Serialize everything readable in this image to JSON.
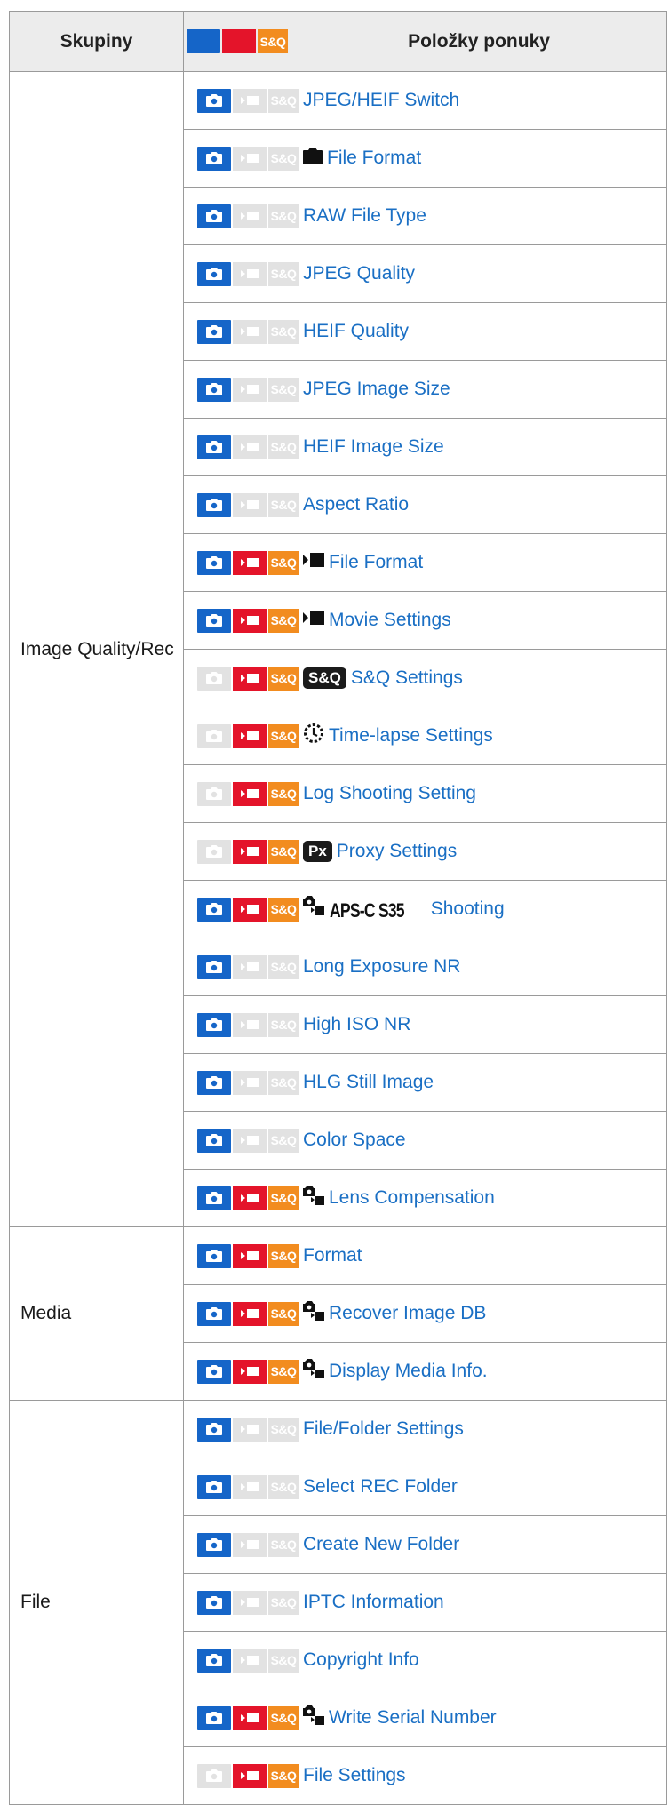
{
  "table": {
    "headers": {
      "groups": "Skupiny",
      "availability": "S&Q",
      "items": "Položky ponuky"
    },
    "groups": [
      {
        "name": "Image Quality/Rec",
        "rows": [
          {
            "label": "JPEG/HEIF Switch",
            "photo": true,
            "movie": false,
            "sq": false,
            "prefix": ""
          },
          {
            "label": "File Format",
            "photo": true,
            "movie": false,
            "sq": false,
            "prefix": "camera-icon"
          },
          {
            "label": "RAW File Type",
            "photo": true,
            "movie": false,
            "sq": false,
            "prefix": ""
          },
          {
            "label": "JPEG Quality",
            "photo": true,
            "movie": false,
            "sq": false,
            "prefix": ""
          },
          {
            "label": "HEIF Quality",
            "photo": true,
            "movie": false,
            "sq": false,
            "prefix": ""
          },
          {
            "label": "JPEG Image Size",
            "photo": true,
            "movie": false,
            "sq": false,
            "prefix": ""
          },
          {
            "label": "HEIF Image Size",
            "photo": true,
            "movie": false,
            "sq": false,
            "prefix": ""
          },
          {
            "label": "Aspect Ratio",
            "photo": true,
            "movie": false,
            "sq": false,
            "prefix": ""
          },
          {
            "label": "File Format",
            "photo": true,
            "movie": true,
            "sq": true,
            "prefix": "movie-icon"
          },
          {
            "label": "Movie Settings",
            "photo": true,
            "movie": true,
            "sq": true,
            "prefix": "movie-icon"
          },
          {
            "label": "S&Q Settings",
            "photo": false,
            "movie": true,
            "sq": true,
            "prefix": "sq-badge-icon"
          },
          {
            "label": "Time-lapse Settings",
            "photo": false,
            "movie": true,
            "sq": true,
            "prefix": "timelapse-icon"
          },
          {
            "label": "Log Shooting Setting",
            "photo": false,
            "movie": true,
            "sq": true,
            "prefix": ""
          },
          {
            "label": "Proxy Settings",
            "photo": false,
            "movie": true,
            "sq": true,
            "prefix": "px-badge-icon"
          },
          {
            "label": "Shooting",
            "photo": true,
            "movie": true,
            "sq": true,
            "prefix": "shared-aps-icon",
            "prefix_text": "APS-C S35"
          },
          {
            "label": "Long Exposure NR",
            "photo": true,
            "movie": false,
            "sq": false,
            "prefix": ""
          },
          {
            "label": "High ISO NR",
            "photo": true,
            "movie": false,
            "sq": false,
            "prefix": ""
          },
          {
            "label": "HLG Still Image",
            "photo": true,
            "movie": false,
            "sq": false,
            "prefix": ""
          },
          {
            "label": "Color Space",
            "photo": true,
            "movie": false,
            "sq": false,
            "prefix": ""
          },
          {
            "label": "Lens Compensation",
            "photo": true,
            "movie": true,
            "sq": true,
            "prefix": "shared-icon"
          }
        ]
      },
      {
        "name": "Media",
        "rows": [
          {
            "label": "Format",
            "photo": true,
            "movie": true,
            "sq": true,
            "prefix": ""
          },
          {
            "label": "Recover Image DB",
            "photo": true,
            "movie": true,
            "sq": true,
            "prefix": "shared-icon"
          },
          {
            "label": "Display Media Info.",
            "photo": true,
            "movie": true,
            "sq": true,
            "prefix": "shared-icon"
          }
        ]
      },
      {
        "name": "File",
        "rows": [
          {
            "label": "File/Folder Settings",
            "photo": true,
            "movie": false,
            "sq": false,
            "prefix": ""
          },
          {
            "label": "Select REC Folder",
            "photo": true,
            "movie": false,
            "sq": false,
            "prefix": ""
          },
          {
            "label": "Create New Folder",
            "photo": true,
            "movie": false,
            "sq": false,
            "prefix": ""
          },
          {
            "label": "IPTC Information",
            "photo": true,
            "movie": false,
            "sq": false,
            "prefix": ""
          },
          {
            "label": "Copyright Info",
            "photo": true,
            "movie": false,
            "sq": false,
            "prefix": ""
          },
          {
            "label": "Write Serial Number",
            "photo": true,
            "movie": true,
            "sq": true,
            "prefix": "shared-icon"
          },
          {
            "label": "File Settings",
            "photo": false,
            "movie": true,
            "sq": true,
            "prefix": ""
          }
        ]
      }
    ],
    "colors": {
      "photo": "#1565c8",
      "movie": "#e4142a",
      "sq": "#f28c1f",
      "disabled": "#e2e2e2",
      "link": "#1a6fc4"
    }
  }
}
